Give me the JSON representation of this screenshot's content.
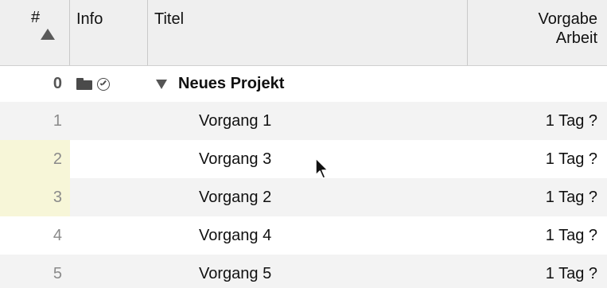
{
  "table": {
    "headers": {
      "number": "#",
      "info": "Info",
      "title": "Titel",
      "work_line1": "Vorgabe",
      "work_line2": "Arbeit"
    },
    "project": {
      "number": "0",
      "title": "Neues Projekt",
      "icons": [
        "folder-icon",
        "clock-icon"
      ]
    },
    "rows": [
      {
        "number": "1",
        "title": "Vorgang 1",
        "work": "1 Tag ?"
      },
      {
        "number": "2",
        "title": "Vorgang 3",
        "work": "1 Tag ?"
      },
      {
        "number": "3",
        "title": "Vorgang 2",
        "work": "1 Tag ?"
      },
      {
        "number": "4",
        "title": "Vorgang 4",
        "work": "1 Tag ?"
      },
      {
        "number": "5",
        "title": "Vorgang 5",
        "work": "1 Tag ?"
      }
    ]
  },
  "colors": {
    "header_bg": "#efefef",
    "alt_row_bg": "#f3f3f3",
    "highlight_bg": "#f7f6d8"
  }
}
